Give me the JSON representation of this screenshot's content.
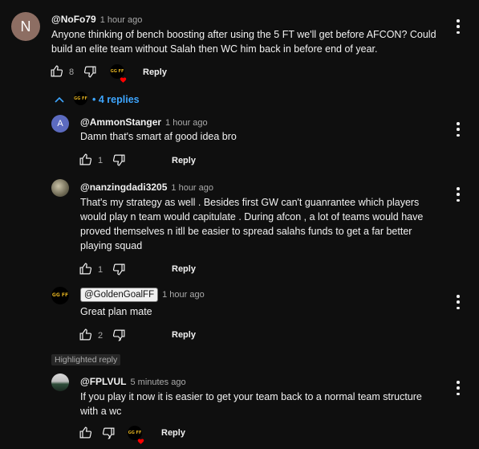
{
  "comment": {
    "avatar_letter": "N",
    "avatar_color": "#8d6e63",
    "handle": "@NoFo79",
    "time": "1 hour ago",
    "text_line1": "Anyone thinking of bench boosting after using the 5 FT we'll get before AFCON? Could",
    "text_line2": "build an elite team without Salah then WC him back in before end of year.",
    "likes": "8",
    "reply_label": "Reply",
    "replies_label": "4 replies"
  },
  "replies": [
    {
      "avatar_letter": "A",
      "avatar_color": "#5c6bc0",
      "handle": "@AmmonStanger",
      "time": "1 hour ago",
      "lines": [
        "Damn that's smart af good idea bro"
      ],
      "likes": "1",
      "reply_label": "Reply"
    },
    {
      "handle": "@nanzingdadi3205",
      "time": "1 hour ago",
      "lines": [
        "That's my strategy as well . Besides first GW can't guanrantee which players",
        "would play n team would capitulate . During afcon , a lot of teams would have",
        "proved themselves n itll be easier to spread salahs funds to get a far better",
        "playing squad"
      ],
      "likes": "1",
      "reply_label": "Reply"
    },
    {
      "handle": "@GoldenGoalFF",
      "time": "1 hour ago",
      "lines": [
        "Great plan mate"
      ],
      "likes": "2",
      "reply_label": "Reply"
    },
    {
      "highlight_label": "Highlighted reply",
      "handle": "@FPLVUL",
      "time": "5 minutes ago",
      "lines": [
        "If you play it now it is easier to get your team back to a normal team structure",
        "with a wc"
      ],
      "likes": "",
      "reply_label": "Reply"
    }
  ],
  "colors": {
    "background": "#0f0f0f",
    "text": "#f1f1f1",
    "secondary": "#aaaaaa",
    "link_blue": "#3ea6ff",
    "heart_red": "#ff0000",
    "logo_gold": "#e0b021"
  },
  "logo_text": "GG FF"
}
